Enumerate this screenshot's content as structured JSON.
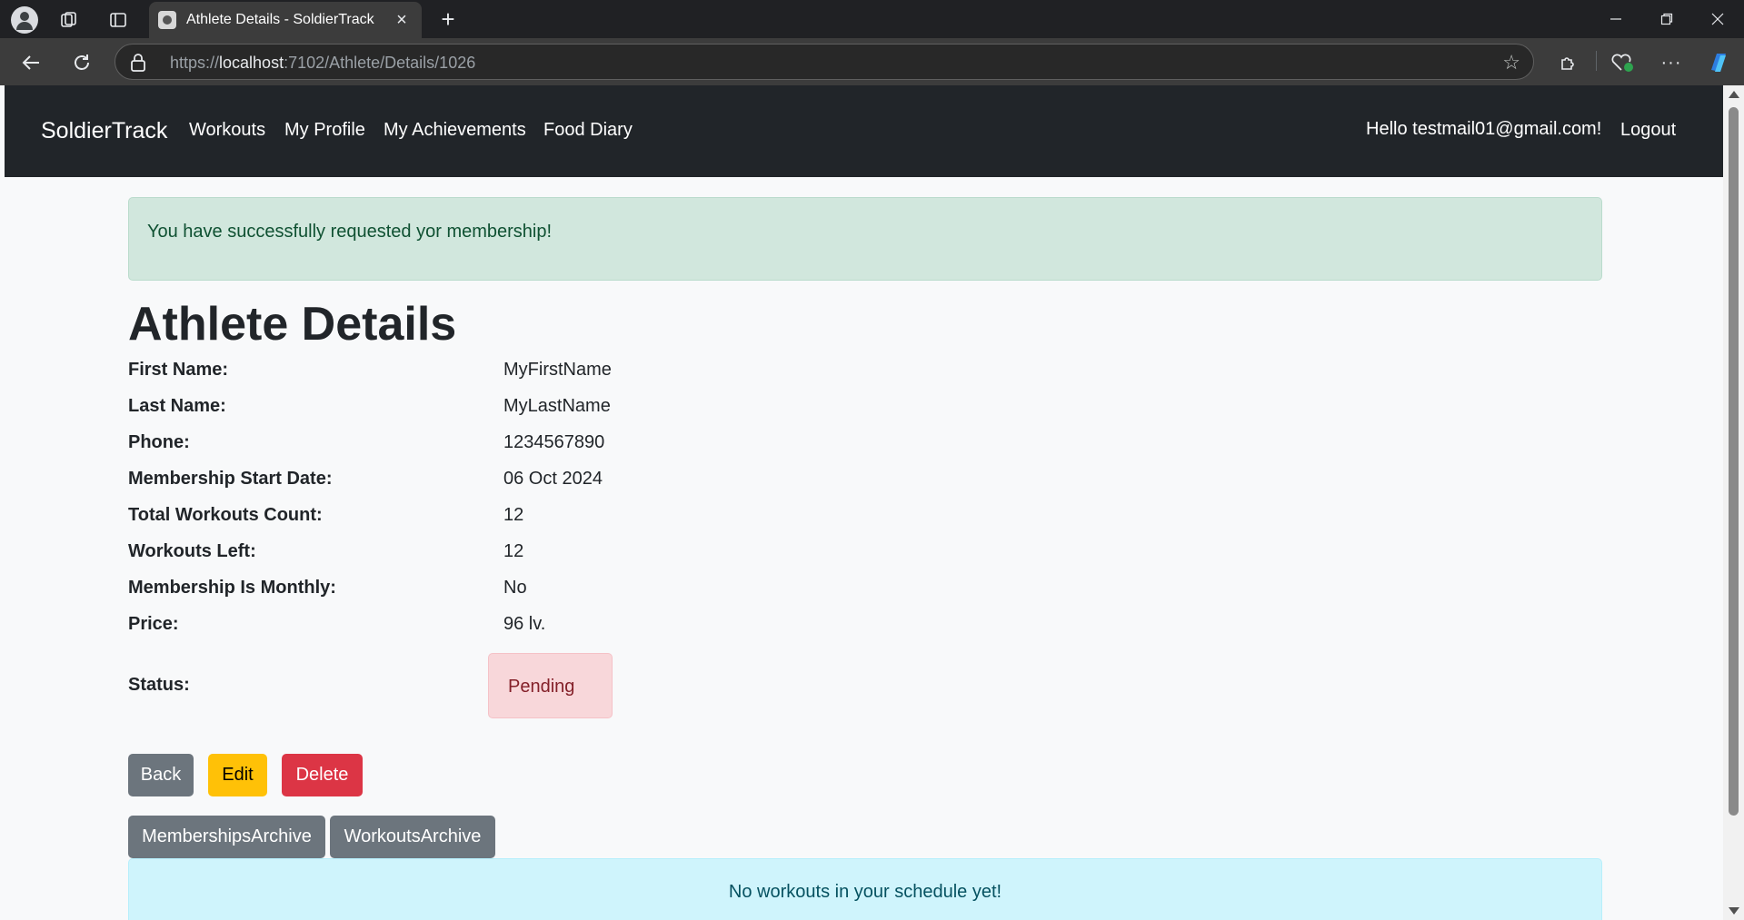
{
  "browser": {
    "tab_title": "Athlete Details - SoldierTrack",
    "url_scheme": "https://",
    "url_host": "localhost",
    "url_rest": ":7102/Athlete/Details/1026"
  },
  "navbar": {
    "brand": "SoldierTrack",
    "links": [
      "Workouts",
      "My Profile",
      "My Achievements",
      "Food Diary"
    ],
    "greeting": "Hello testmail01@gmail.com!",
    "logout": "Logout"
  },
  "alerts": {
    "success": "You have successfully requested yor membership!",
    "info": "No workouts in your schedule yet!"
  },
  "page": {
    "title": "Athlete Details"
  },
  "details": [
    {
      "label": "First Name:",
      "value": "MyFirstName"
    },
    {
      "label": "Last Name:",
      "value": "MyLastName"
    },
    {
      "label": "Phone:",
      "value": "1234567890"
    },
    {
      "label": "Membership Start Date:",
      "value": "06 Oct 2024"
    },
    {
      "label": "Total Workouts Count:",
      "value": "12"
    },
    {
      "label": "Workouts Left:",
      "value": "12"
    },
    {
      "label": "Membership Is Monthly:",
      "value": "No"
    },
    {
      "label": "Price:",
      "value": "96 lv."
    }
  ],
  "status": {
    "label": "Status:",
    "value": "Pending"
  },
  "buttons": {
    "back": "Back",
    "edit": "Edit",
    "delete": "Delete",
    "memberships_archive": "MembershipsArchive",
    "workouts_archive": "WorkoutsArchive"
  },
  "colors": {
    "navbar": "#212529",
    "success_bg": "#d1e7dd",
    "info_bg": "#cff4fc",
    "danger_badge_bg": "#f8d7da",
    "secondary": "#6c757d",
    "warning": "#ffc107",
    "danger": "#dc3545"
  }
}
